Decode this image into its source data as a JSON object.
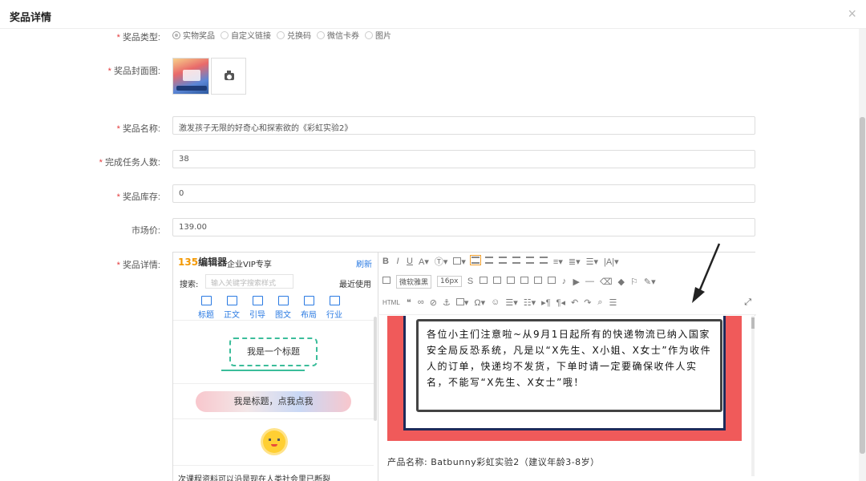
{
  "header": {
    "title": "奖品详情",
    "close_glyph": "×"
  },
  "form": {
    "prize_type": {
      "label": "奖品类型:",
      "options": [
        "实物奖品",
        "自定义链接",
        "兑换码",
        "微信卡券",
        "图片"
      ],
      "selected": "实物奖品"
    },
    "cover": {
      "label": "奖品封面图:",
      "upload_icon": "camera-icon"
    },
    "name": {
      "label": "奖品名称:",
      "value": "激发孩子无限的好奇心和探索欲的《彩虹实验2》"
    },
    "task_count": {
      "label": "完成任务人数:",
      "value": "38"
    },
    "stock": {
      "label": "奖品库存:",
      "value": "0"
    },
    "market_price": {
      "label": "市场价:",
      "value": "139.00"
    },
    "detail": {
      "label": "奖品详情:"
    }
  },
  "editor_panel": {
    "logo_number": "135",
    "logo_text": "编辑器",
    "vip_text": "企业VIP专享",
    "refresh": "刷新",
    "search_label": "搜索:",
    "search_placeholder": "输入关键字搜索样式",
    "recent": "最近使用",
    "categories": [
      "标题",
      "正文",
      "引导",
      "图文",
      "布局",
      "行业"
    ],
    "template_title_1": "我是一个标题",
    "template_title_2": "我是标题，点我点我",
    "bottom_text": "次课程资料可以沿是现在人类社会里已断裂"
  },
  "toolbar": {
    "font_family": "微软雅黑",
    "font_size": "16px"
  },
  "content": {
    "notice": "各位小主们注意啦~从9月1日起所有的快递物流已纳入国家安全局反恐系统，凡是以“X先生、X小姐、X女士”作为收件人的订单，快递均不发货，下单时请一定要确保收件人实名，不能写“X先生、X女士”哦！",
    "product_line": "产品名称: Batbunny彩虹实验2（建议年龄3-8岁）"
  },
  "colors": {
    "accent": "#2a7ae2",
    "required": "#e4393c",
    "banner": "#f05a5a",
    "frame": "#1e2a5a"
  }
}
